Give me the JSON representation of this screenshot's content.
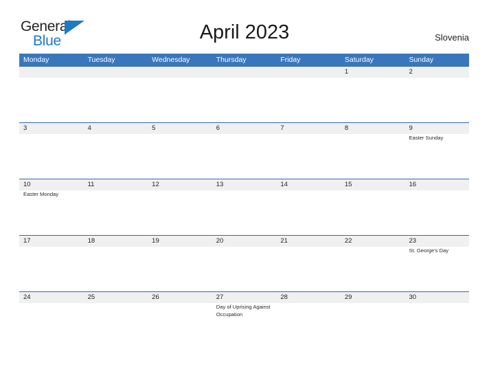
{
  "brand": {
    "name_part1": "General",
    "name_part2": "Blue",
    "flag_icon": "blue-flag-triangle",
    "dark_color": "#231f20",
    "blue_color": "#1f7ac4"
  },
  "header": {
    "title": "April 2023",
    "region": "Slovenia"
  },
  "theme": {
    "header_blue": "#3a76bc",
    "row_line_blue": "#2f6aad",
    "day_strip_gray": "#f0f0f0",
    "text_color": "#222222"
  },
  "calendar": {
    "month": "April",
    "year": "2023",
    "weekdays": [
      "Monday",
      "Tuesday",
      "Wednesday",
      "Thursday",
      "Friday",
      "Saturday",
      "Sunday"
    ],
    "weeks": [
      {
        "days": [
          {
            "number": "",
            "event": ""
          },
          {
            "number": "",
            "event": ""
          },
          {
            "number": "",
            "event": ""
          },
          {
            "number": "",
            "event": ""
          },
          {
            "number": "",
            "event": ""
          },
          {
            "number": "1",
            "event": ""
          },
          {
            "number": "2",
            "event": ""
          }
        ]
      },
      {
        "days": [
          {
            "number": "3",
            "event": ""
          },
          {
            "number": "4",
            "event": ""
          },
          {
            "number": "5",
            "event": ""
          },
          {
            "number": "6",
            "event": ""
          },
          {
            "number": "7",
            "event": ""
          },
          {
            "number": "8",
            "event": ""
          },
          {
            "number": "9",
            "event": "Easter Sunday"
          }
        ]
      },
      {
        "days": [
          {
            "number": "10",
            "event": "Easter Monday"
          },
          {
            "number": "11",
            "event": ""
          },
          {
            "number": "12",
            "event": ""
          },
          {
            "number": "13",
            "event": ""
          },
          {
            "number": "14",
            "event": ""
          },
          {
            "number": "15",
            "event": ""
          },
          {
            "number": "16",
            "event": ""
          }
        ]
      },
      {
        "days": [
          {
            "number": "17",
            "event": ""
          },
          {
            "number": "18",
            "event": ""
          },
          {
            "number": "19",
            "event": ""
          },
          {
            "number": "20",
            "event": ""
          },
          {
            "number": "21",
            "event": ""
          },
          {
            "number": "22",
            "event": ""
          },
          {
            "number": "23",
            "event": "St. George's Day"
          }
        ]
      },
      {
        "days": [
          {
            "number": "24",
            "event": ""
          },
          {
            "number": "25",
            "event": ""
          },
          {
            "number": "26",
            "event": ""
          },
          {
            "number": "27",
            "event": "Day of Uprising Against Occupation"
          },
          {
            "number": "28",
            "event": ""
          },
          {
            "number": "29",
            "event": ""
          },
          {
            "number": "30",
            "event": ""
          }
        ]
      }
    ]
  }
}
